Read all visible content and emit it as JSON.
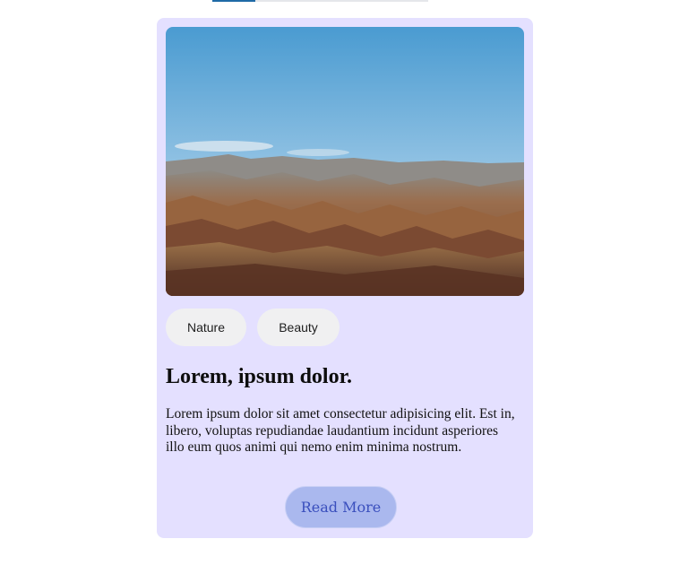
{
  "progress": {
    "value": 0.2
  },
  "card": {
    "image_alt": "Mountain landscape",
    "tags": [
      {
        "label": "Nature"
      },
      {
        "label": "Beauty"
      }
    ],
    "title": "Lorem, ipsum dolor.",
    "description": "Lorem ipsum dolor sit amet consectetur adipisicing elit. Est in, libero, voluptas repudiandae laudantium incidunt asperiores illo eum quos animi qui nemo enim minima nostrum.",
    "button_label": "Read More"
  },
  "colors": {
    "card_background": "#e4e0ff",
    "tag_background": "#f0f0f1",
    "button_background": "#aab8ee",
    "button_text": "#3a4fbd",
    "progress_fill": "#1f6aa6"
  }
}
